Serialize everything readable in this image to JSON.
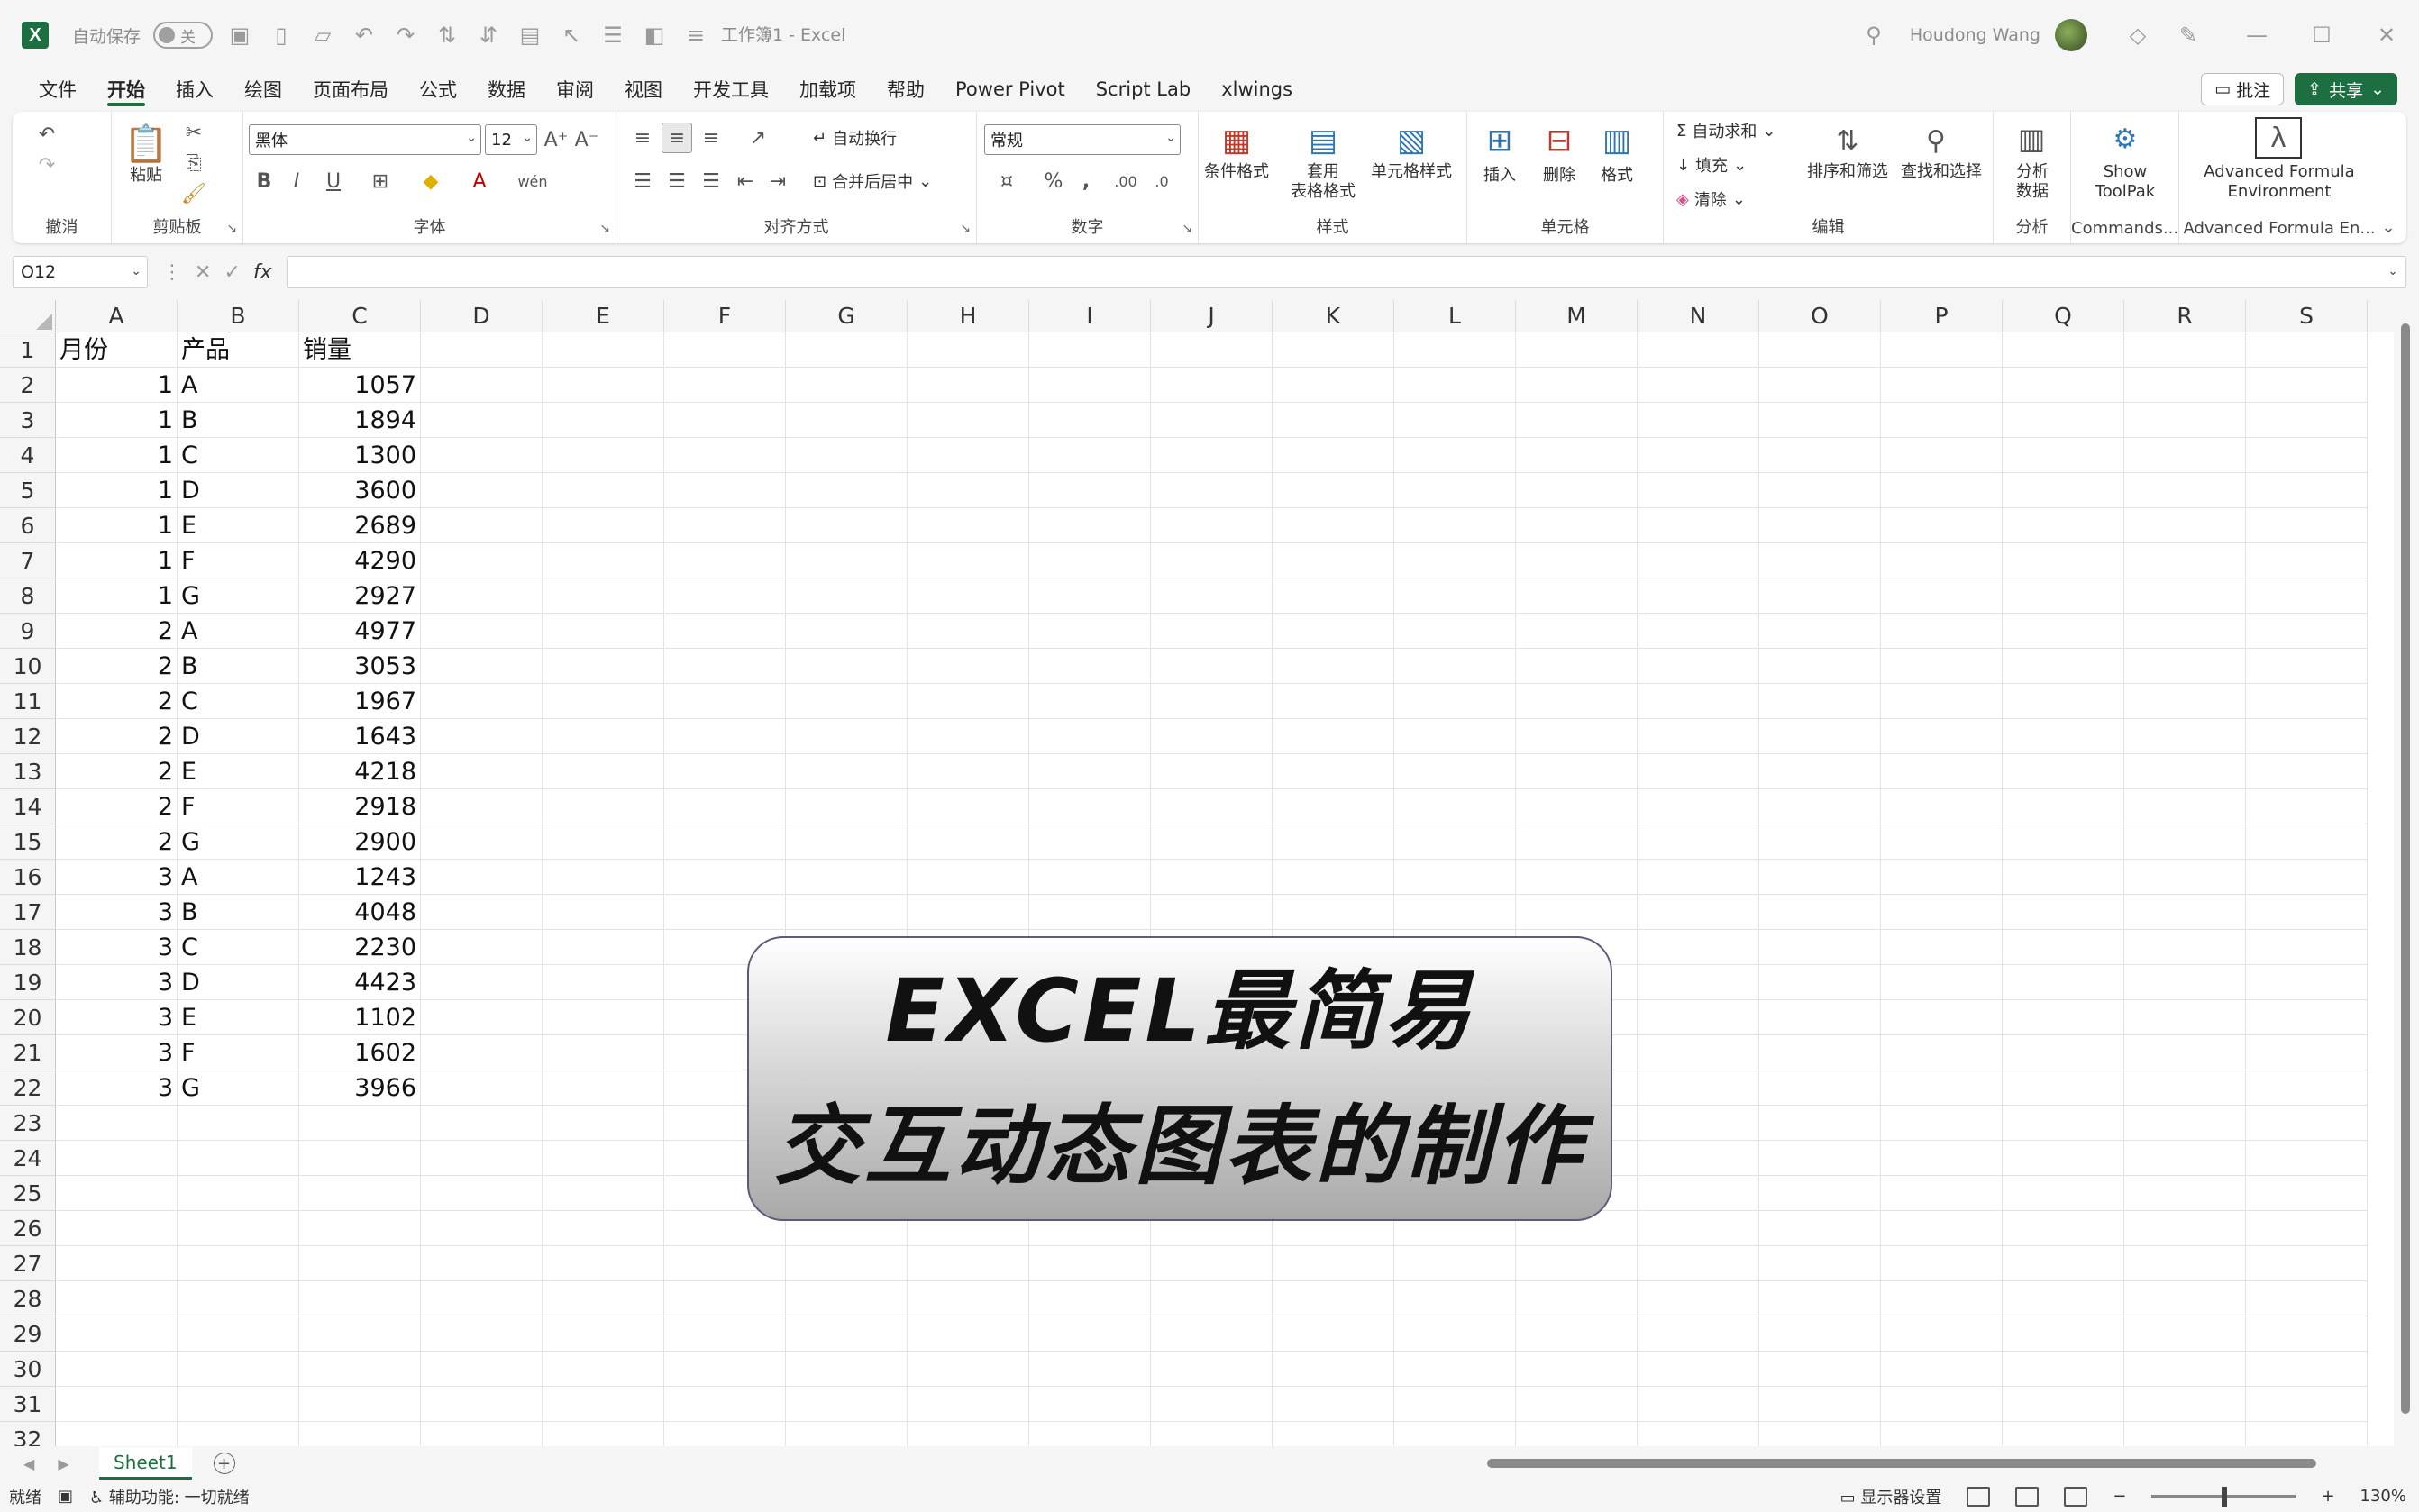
{
  "titlebar": {
    "logo": "X",
    "autosave_label": "自动保存",
    "autosave_state": "关",
    "doc_title": "工作簿1 - Excel",
    "user_name": "Houdong Wang"
  },
  "menu": {
    "items": [
      "文件",
      "开始",
      "插入",
      "绘图",
      "页面布局",
      "公式",
      "数据",
      "审阅",
      "视图",
      "开发工具",
      "加载项",
      "帮助",
      "Power Pivot",
      "Script Lab",
      "xlwings"
    ],
    "active": "开始",
    "comment_label": "批注",
    "share_label": "共享"
  },
  "ribbon": {
    "groups": {
      "undo": "撤消",
      "clipboard": "剪贴板",
      "font": "字体",
      "alignment": "对齐方式",
      "number": "数字",
      "styles": "样式",
      "cells": "单元格",
      "editing": "编辑",
      "analysis": "分析",
      "commands": "Commands...",
      "afe": "Advanced Formula En..."
    },
    "paste_label": "粘贴",
    "font_name": "黑体",
    "font_size": "12",
    "wrap_text": "自动换行",
    "merge_center": "合并后居中",
    "number_format": "常规",
    "cond_format": "条件格式",
    "table_format_1": "套用",
    "table_format_2": "表格格式",
    "cell_styles": "单元格样式",
    "insert": "插入",
    "delete": "删除",
    "format": "格式",
    "autosum": "自动求和",
    "fill": "填充",
    "clear": "清除",
    "sort_filter": "排序和筛选",
    "find_select": "查找和选择",
    "analyze_1": "分析",
    "analyze_2": "数据",
    "toolpak_1": "Show",
    "toolpak_2": "ToolPak",
    "afe_1": "Advanced Formula",
    "afe_2": "Environment"
  },
  "formula_bar": {
    "name_box": "O12",
    "fx": "fx",
    "value": ""
  },
  "sheet": {
    "columns": [
      "A",
      "B",
      "C",
      "D",
      "E",
      "F",
      "G",
      "H",
      "I",
      "J",
      "K",
      "L",
      "M",
      "N",
      "O",
      "P",
      "Q",
      "R",
      "S"
    ],
    "header_row": [
      "月份",
      "产品",
      "销量"
    ],
    "rows": [
      [
        "1",
        "A",
        "1057"
      ],
      [
        "1",
        "B",
        "1894"
      ],
      [
        "1",
        "C",
        "1300"
      ],
      [
        "1",
        "D",
        "3600"
      ],
      [
        "1",
        "E",
        "2689"
      ],
      [
        "1",
        "F",
        "4290"
      ],
      [
        "1",
        "G",
        "2927"
      ],
      [
        "2",
        "A",
        "4977"
      ],
      [
        "2",
        "B",
        "3053"
      ],
      [
        "2",
        "C",
        "1967"
      ],
      [
        "2",
        "D",
        "1643"
      ],
      [
        "2",
        "E",
        "4218"
      ],
      [
        "2",
        "F",
        "2918"
      ],
      [
        "2",
        "G",
        "2900"
      ],
      [
        "3",
        "A",
        "1243"
      ],
      [
        "3",
        "B",
        "4048"
      ],
      [
        "3",
        "C",
        "2230"
      ],
      [
        "3",
        "D",
        "4423"
      ],
      [
        "3",
        "E",
        "1102"
      ],
      [
        "3",
        "F",
        "1602"
      ],
      [
        "3",
        "G",
        "3966"
      ]
    ],
    "row_count": 32
  },
  "overlay": {
    "line1": "EXCEL最简易",
    "line2": "交互动态图表的制作"
  },
  "tabs": {
    "sheet_name": "Sheet1"
  },
  "status": {
    "ready": "就绪",
    "accessibility": "辅助功能: 一切就绪",
    "display_settings": "显示器设置",
    "zoom": "130%"
  }
}
